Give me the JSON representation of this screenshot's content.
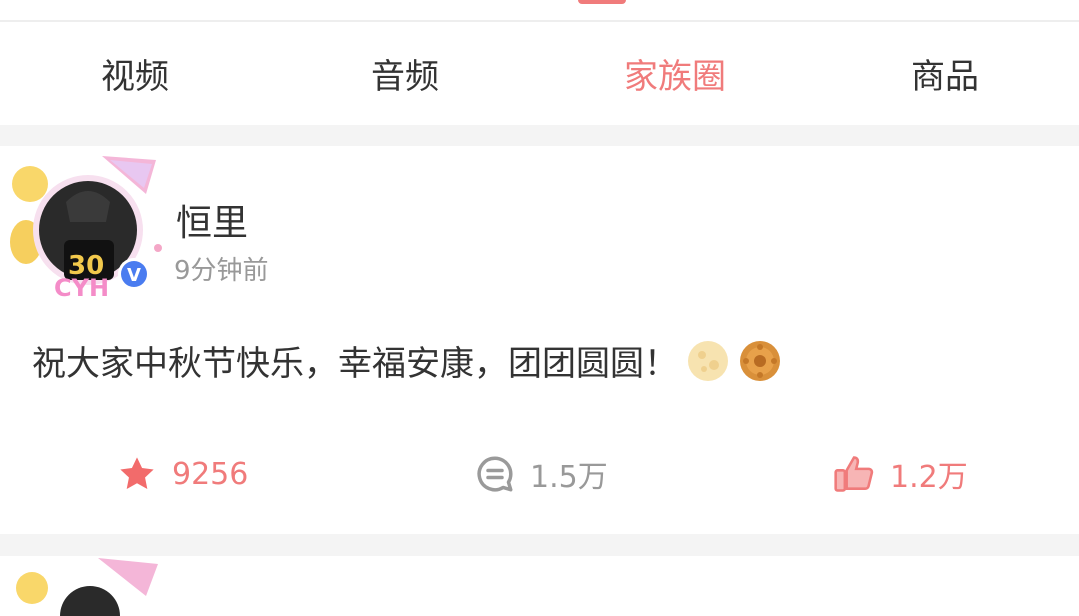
{
  "theme": {
    "accent": "#f07b7b",
    "text": "#333333",
    "muted": "#999999",
    "verified": "#4a7cf0"
  },
  "tabs": [
    {
      "label": "视频",
      "active": false
    },
    {
      "label": "音频",
      "active": false
    },
    {
      "label": "家族圈",
      "active": true
    },
    {
      "label": "商品",
      "active": false
    }
  ],
  "post": {
    "author": "恒里",
    "time": "9分钟前",
    "text": "祝大家中秋节快乐，幸福安康，团团圆圆！",
    "emojis": [
      "moon-icon",
      "mooncake-icon"
    ],
    "avatar_badge": "V",
    "jersey_number": "30",
    "frame_text": "CYH",
    "actions": {
      "favorite": {
        "icon": "star-icon",
        "count": "9256"
      },
      "comment": {
        "icon": "comment-icon",
        "count": "1.5万"
      },
      "like": {
        "icon": "thumbs-up-icon",
        "count": "1.2万"
      }
    }
  }
}
